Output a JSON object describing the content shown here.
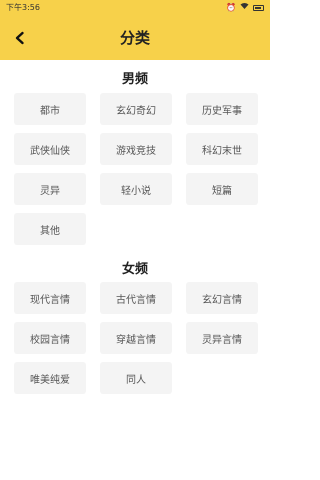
{
  "status_bar": {
    "time": "下午3:56",
    "indicators": [
      "alarm-icon",
      "wifi-icon",
      "battery-icon"
    ]
  },
  "header": {
    "title": "分类",
    "back_icon": "back-arrow-icon"
  },
  "sections": [
    {
      "title": "男频",
      "items": [
        "都市",
        "玄幻奇幻",
        "历史军事",
        "武侠仙侠",
        "游戏竞技",
        "科幻末世",
        "灵异",
        "轻小说",
        "短篇",
        "其他"
      ]
    },
    {
      "title": "女频",
      "items": [
        "现代言情",
        "古代言情",
        "玄幻言情",
        "校园言情",
        "穿越言情",
        "灵异言情",
        "唯美纯爱",
        "同人"
      ]
    }
  ],
  "colors": {
    "accent": "#f7d14a",
    "chip_bg": "#f4f4f4",
    "chip_text": "#555555"
  }
}
